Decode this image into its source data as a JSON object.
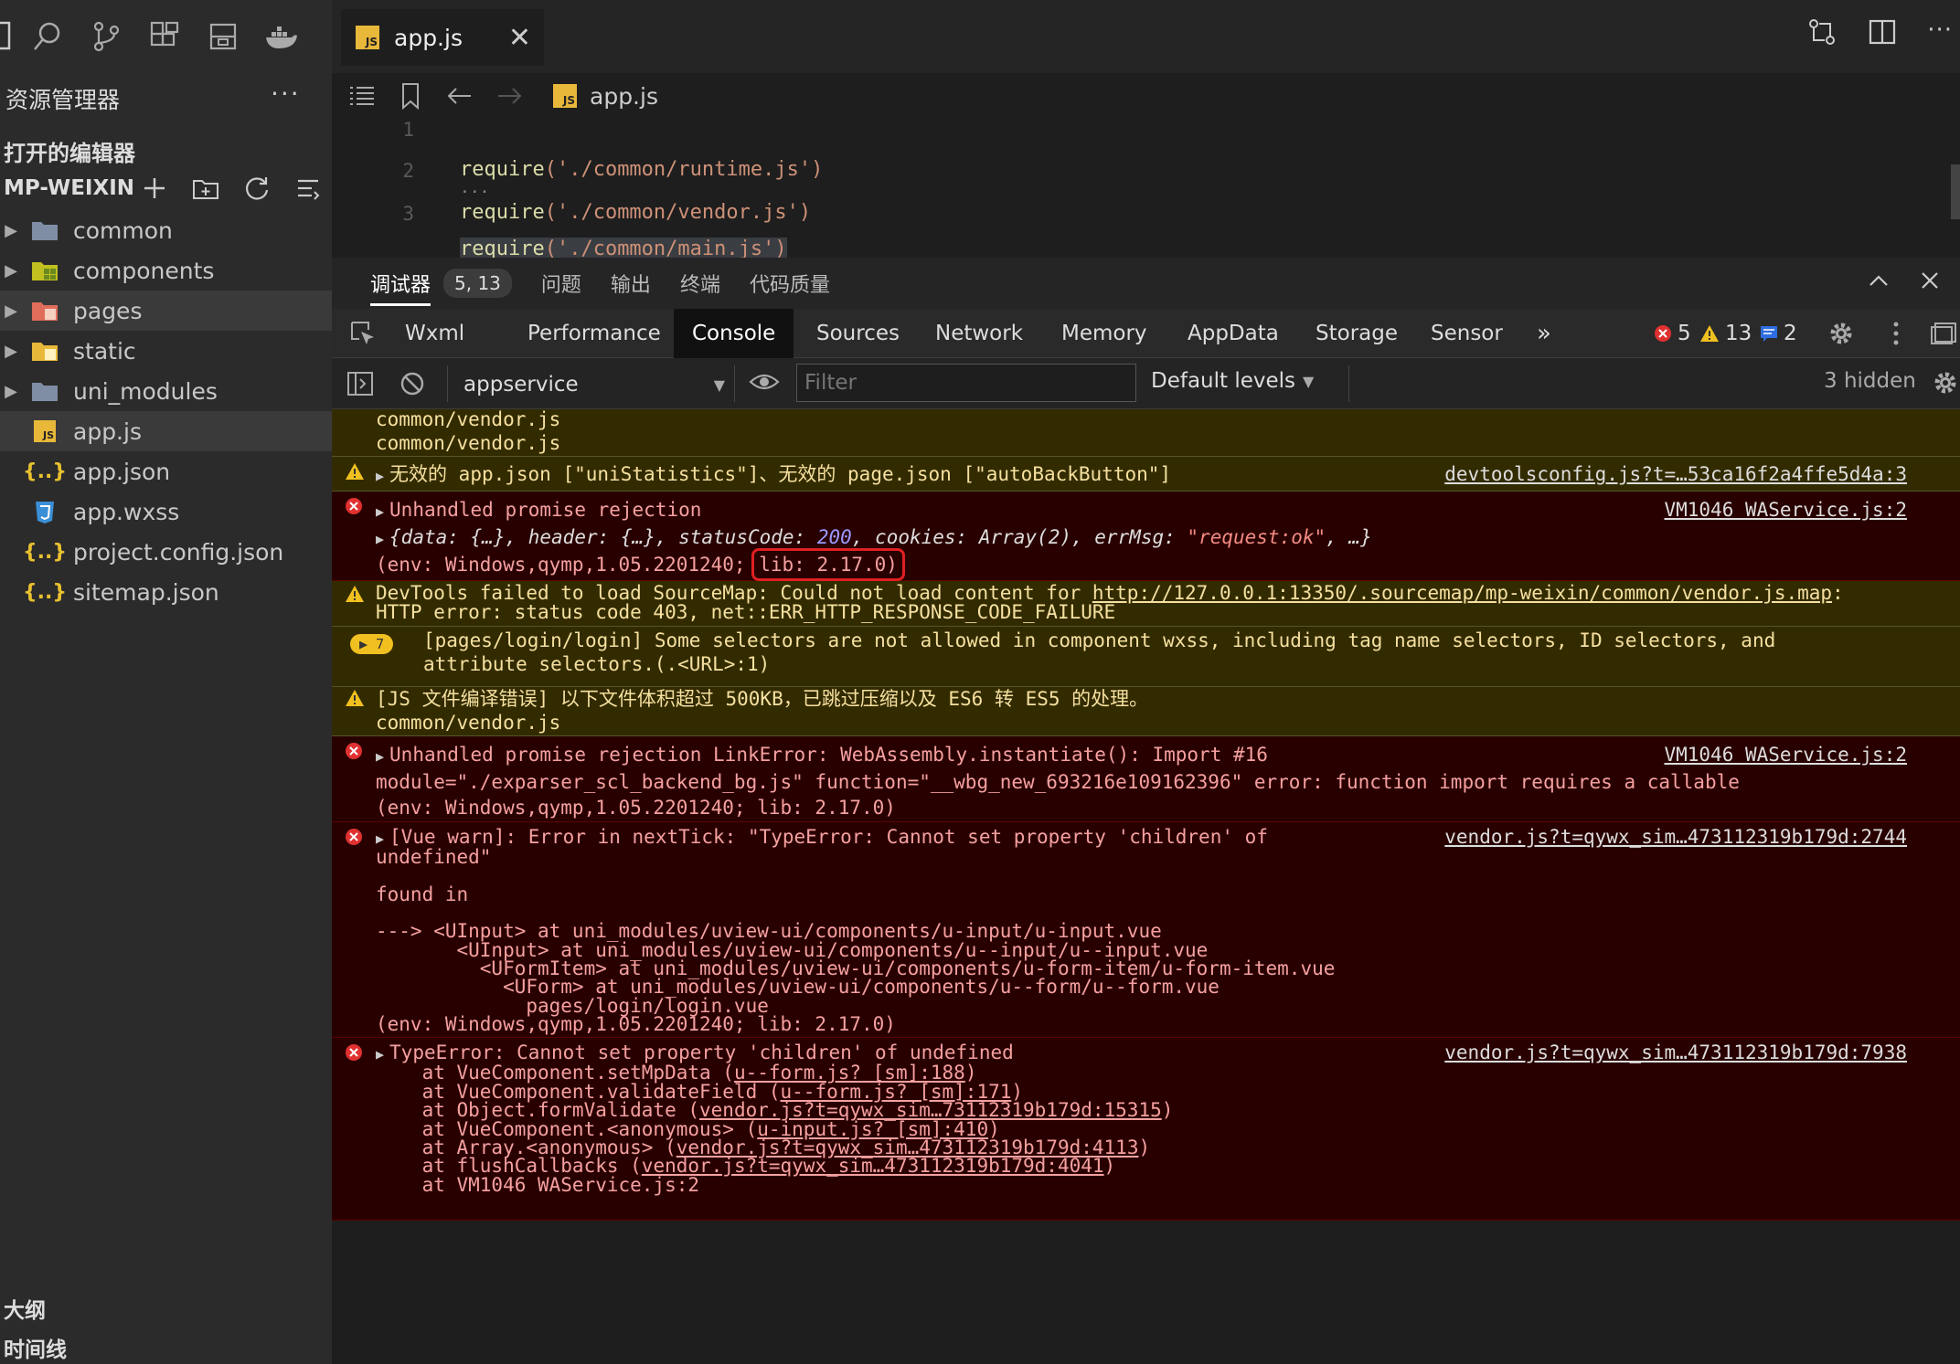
{
  "sidebar": {
    "title": "资源管理器",
    "more": "···",
    "open_editors": "打开的编辑器",
    "project": "MP-WEIXIN",
    "tree": [
      {
        "label": "common",
        "type": "folder",
        "icon": "folder-icon"
      },
      {
        "label": "components",
        "type": "folder",
        "icon": "components-folder-icon"
      },
      {
        "label": "pages",
        "type": "folder",
        "icon": "pages-folder-icon"
      },
      {
        "label": "static",
        "type": "folder",
        "icon": "static-folder-icon"
      },
      {
        "label": "uni_modules",
        "type": "folder",
        "icon": "folder-icon"
      },
      {
        "label": "app.js",
        "type": "file",
        "icon": "js-file-icon"
      },
      {
        "label": "app.json",
        "type": "file",
        "icon": "json-file-icon"
      },
      {
        "label": "app.wxss",
        "type": "file",
        "icon": "css-file-icon"
      },
      {
        "label": "project.config.json",
        "type": "file",
        "icon": "json-file-icon"
      },
      {
        "label": "sitemap.json",
        "type": "file",
        "icon": "json-file-icon"
      }
    ],
    "outline": "大纲",
    "timeline": "时间线"
  },
  "editor": {
    "tab_label": "app.js",
    "tab_badge": "JS",
    "breadcrumb_file": "app.js",
    "lines": [
      {
        "n": "1",
        "text": ""
      },
      {
        "n": "2",
        "fn": "require",
        "arg": "('./common/runtime.js')"
      },
      {
        "n": "3",
        "fn": "require",
        "arg": "('./common/vendor.js')"
      },
      {
        "n": "",
        "fn": "require",
        "arg": "('./common/main.js')"
      }
    ]
  },
  "panel": {
    "tabs": {
      "debugger": "调试器",
      "badge": "5, 13",
      "problems": "问题",
      "output": "输出",
      "terminal": "终端",
      "quality": "代码质量"
    }
  },
  "devtools": {
    "tabs": [
      "Wxml",
      "Performance",
      "Console",
      "Sources",
      "Network",
      "Memory",
      "AppData",
      "Storage",
      "Sensor"
    ],
    "more": "»",
    "errors": "5",
    "warnings": "13",
    "infos": "2",
    "context": "appservice",
    "filter_placeholder": "Filter",
    "levels": "Default levels",
    "hidden": "3 hidden"
  },
  "console": {
    "m0_l1": "common/vendor.js",
    "m0_l2": "common/vendor.js",
    "m1_text": "无效的 app.json [\"uniStatistics\"]、无效的 page.json [\"autoBackButton\"]",
    "m1_src": "devtoolsconfig.js?t=…53ca16f2a4ffe5d4a:3",
    "m2_l1": "Unhandled promise rejection",
    "m2_src": "VM1046 WAService.js:2",
    "m2_obj_a": "{data: {…}, header: {…}, statusCode: ",
    "m2_obj_num": "200",
    "m2_obj_b": ", cookies: Array(2), errMsg: ",
    "m2_obj_str": "\"request:ok\"",
    "m2_obj_c": ", …}",
    "m2_env": "(env: Windows,qymp,1.05.2201240; ",
    "m2_lib": "lib: 2.17.0)",
    "m3_a": "DevTools failed to load SourceMap: Could not load content for ",
    "m3_link": "http://127.0.0.1:13350/.sourcemap/mp-weixin/common/vendor.js.map",
    "m3_b": ":",
    "m3_l2": "HTTP error: status code 403, net::ERR_HTTP_RESPONSE_CODE_FAILURE",
    "m4_count": "7",
    "m4_l1": "[pages/login/login] Some selectors are not allowed in component wxss, including tag name selectors, ID selectors, and",
    "m4_l2": "attribute selectors.(.<URL>:1)",
    "m5_l1": "[JS 文件编译错误] 以下文件体积超过 500KB，已跳过压缩以及 ES6 转 ES5 的处理。",
    "m5_l2": "common/vendor.js",
    "m6_l1": "Unhandled promise rejection LinkError: WebAssembly.instantiate(): Import #16",
    "m6_src": "VM1046 WAService.js:2",
    "m6_l2": "module=\"./exparser_scl_backend_bg.js\" function=\"__wbg_new_693216e109162396\" error: function import requires a callable",
    "m6_l3": "(env: Windows,qymp,1.05.2201240; lib: 2.17.0)",
    "m7_l1": "[Vue warn]: Error in nextTick: \"TypeError: Cannot set property 'children' of",
    "m7_src": "vendor.js?t=qywx_sim…473112319b179d:2744",
    "m7_l2": "undefined\"",
    "m7_l3": "",
    "m7_l4": "found in",
    "m7_l5": "",
    "m7_l6": "---> <UInput> at uni_modules/uview-ui/components/u-input/u-input.vue",
    "m7_l7": "       <UInput> at uni_modules/uview-ui/components/u--input/u--input.vue",
    "m7_l8": "         <UFormItem> at uni_modules/uview-ui/components/u-form-item/u-form-item.vue",
    "m7_l9": "           <UForm> at uni_modules/uview-ui/components/u--form/u--form.vue",
    "m7_l10": "             pages/login/login.vue",
    "m7_l11": "(env: Windows,qymp,1.05.2201240; lib: 2.17.0)",
    "m8_l1": "TypeError: Cannot set property 'children' of undefined",
    "m8_src": "vendor.js?t=qywx_sim…473112319b179d:7938",
    "m8_stack": [
      {
        "pre": "    at VueComponent.setMpData (",
        "link": "u--form.js? [sm]:188",
        "post": ")"
      },
      {
        "pre": "    at VueComponent.validateField (",
        "link": "u--form.js? [sm]:171",
        "post": ")"
      },
      {
        "pre": "    at Object.formValidate (",
        "link": "vendor.js?t=qywx_sim…73112319b179d:15315",
        "post": ")"
      },
      {
        "pre": "    at VueComponent.<anonymous> (",
        "link": "u-input.js? [sm]:410",
        "post": ")"
      },
      {
        "pre": "    at Array.<anonymous> (",
        "link": "vendor.js?t=qywx_sim…473112319b179d:4113",
        "post": ")"
      },
      {
        "pre": "    at flushCallbacks (",
        "link": "vendor.js?t=qywx_sim…473112319b179d:4041",
        "post": ")"
      },
      {
        "pre": "    at VM1046 WAService.js:2",
        "link": "",
        "post": ""
      }
    ]
  },
  "colors": {
    "highlight_box": "#e02020",
    "warn_bg": "#332b00",
    "err_bg": "#290000"
  }
}
